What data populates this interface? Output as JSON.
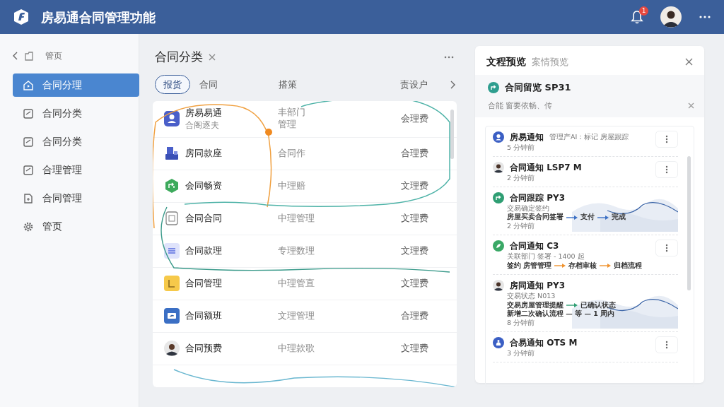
{
  "app": {
    "title": "房易通合同管理功能",
    "notification_count": "1"
  },
  "sidebar": {
    "back_label": "管页",
    "items": [
      {
        "label": "合同分理",
        "kind": "home",
        "selected": true
      },
      {
        "label": "合同分类",
        "kind": "note",
        "selected": false
      },
      {
        "label": "合同分类",
        "kind": "note",
        "selected": false
      },
      {
        "label": "合理管理",
        "kind": "note",
        "selected": false
      },
      {
        "label": "合同管理",
        "kind": "doc",
        "selected": false
      },
      {
        "label": "管页",
        "kind": "gear",
        "selected": false
      }
    ]
  },
  "main": {
    "title": "合同分类",
    "tabs": [
      {
        "label": "报货",
        "selected": true
      },
      {
        "label": "合同",
        "selected": false
      },
      {
        "label": "搭策",
        "selected": false
      },
      {
        "label": "责设户",
        "selected": false
      }
    ],
    "rows": [
      {
        "kind": "user",
        "name": "房易易通",
        "subtitle": "合阁逐夫",
        "column_2": [
          "丰部门",
          "管理"
        ],
        "column_3": "会理费"
      },
      {
        "kind": "building",
        "name": "房同款座",
        "column_2": [
          "合同作"
        ],
        "column_3": "合理费"
      },
      {
        "kind": "hex",
        "name": "会同畅资",
        "column_2": [
          "中理赔"
        ],
        "column_3": "文理费"
      },
      {
        "kind": "doc",
        "name": "合同合同",
        "column_2": [
          "中理管理"
        ],
        "column_3": "文理费"
      },
      {
        "kind": "list",
        "name": "合同款理",
        "column_2": [
          "专理数理"
        ],
        "column_3": "文理费"
      },
      {
        "kind": "yellow",
        "name": "合同管理",
        "column_2": [
          "中理管直"
        ],
        "column_3": "文理费"
      },
      {
        "kind": "card",
        "name": "合同额班",
        "column_2": [
          "文理管理"
        ],
        "column_3": "合理费"
      },
      {
        "kind": "person",
        "name": "合同预费",
        "column_2": [
          "中理款歌"
        ],
        "column_3": "文理费"
      }
    ]
  },
  "preview": {
    "title": "文程预览",
    "subtitle": "案情预览",
    "pinned": {
      "title": "合同留览 SP31",
      "text": "合能 窗要依畅、传"
    },
    "feed": [
      {
        "kind": "user",
        "title": "房易通知",
        "meta": "管理产AI：标记 房屋跟踪",
        "time": "5 分钟前",
        "menu": true,
        "chart": false
      },
      {
        "kind": "person",
        "title": "合同通知 LSP7 M",
        "time": "2 分钟前",
        "menu": true,
        "chart": false
      },
      {
        "kind": "arrow",
        "title": "合同跟踪 PY3",
        "lines": [
          "交易确定签约"
        ],
        "flow": [
          "房屋买卖合同签署",
          "支付",
          "完成"
        ],
        "time": "2 分钟前",
        "menu": false,
        "chart": true
      },
      {
        "kind": "leaf",
        "title": "合同通知 C3",
        "lines": [
          "关联部门 签署 - 1400 起"
        ],
        "flow": [
          "签约 房管管理",
          "存档审核",
          "归档流程"
        ],
        "menu": true,
        "chart": false
      },
      {
        "kind": "face",
        "title": "房同通知 PY3",
        "lines": [
          "交易状态 N013"
        ],
        "flow": [
          "交易房屋管理提醒",
          "已确认状态"
        ],
        "after": [
          "新增二次确认流程 — 等 — 1 周内"
        ],
        "time": "8 分钟前",
        "menu": false,
        "chart": true
      },
      {
        "kind": "bag",
        "title": "合易通知 OTS M",
        "time": "3 分钟前",
        "menu": true,
        "chart": false
      }
    ]
  }
}
